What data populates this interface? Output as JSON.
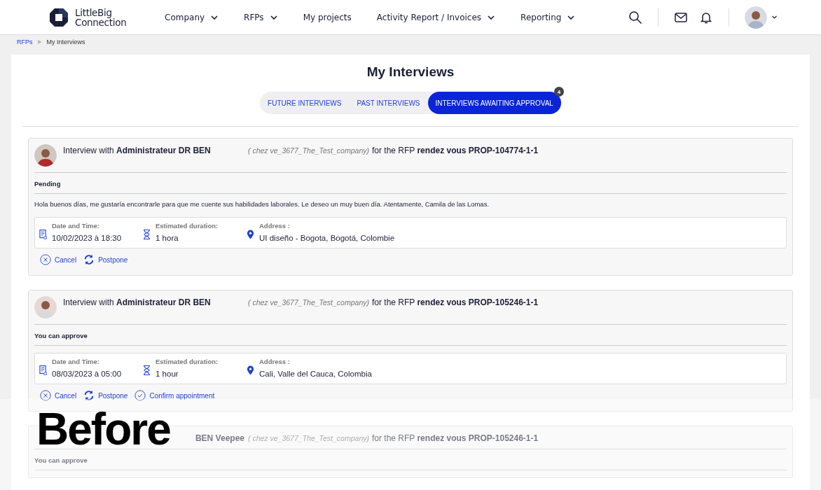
{
  "header": {
    "logo": {
      "line1": "LittleBig",
      "line2": "Connection"
    },
    "nav": [
      {
        "label": "Company",
        "dropdown": true
      },
      {
        "label": "RFPs",
        "dropdown": true
      },
      {
        "label": "My projects",
        "dropdown": false
      },
      {
        "label": "Activity Report / Invoices",
        "dropdown": true
      },
      {
        "label": "Reporting",
        "dropdown": true
      }
    ]
  },
  "breadcrumb": [
    {
      "label": "RFPs",
      "kind": "link"
    },
    {
      "label": "My Interviews",
      "kind": "current"
    }
  ],
  "title": "My Interviews",
  "tabs": [
    {
      "label": "FUTURE INTERVIEWS",
      "selected": false
    },
    {
      "label": "PAST INTERVIEWS",
      "selected": false
    },
    {
      "label": "INTERVIEWS AWAITING APPROVAL",
      "selected": true,
      "badge": "4"
    }
  ],
  "cards": [
    {
      "lead": "Interview with **Administrateur DR BEN**",
      "lead_partial": false,
      "company": "( chez ve_3677_The_Test_company)",
      "rfp": "for the RFP **rendez vous PROP-104774-1-1**",
      "status": "Pending",
      "message": "Hola buenos días, me gustaría encontrarle para que me cuente sus habilidades laborales. Le deseo un muy buen día. Atentamente, Camila de las Lomas.",
      "details": [
        {
          "kind": "date",
          "label": "Date and Time:",
          "value": "10/02/2023 à 18:30"
        },
        {
          "kind": "duration",
          "label": "Estimated duration:",
          "value": "1 hora"
        },
        {
          "kind": "address",
          "label": "Address :",
          "value": "UI diseño - Bogota, Bogotá, Colombie"
        }
      ],
      "actions": [
        {
          "kind": "cancel",
          "label": "Cancel"
        },
        {
          "kind": "postpone",
          "label": "Postpone"
        }
      ]
    },
    {
      "lead": "Interview with **Administrateur DR BEN**",
      "lead_partial": false,
      "company": "( chez ve_3677_The_Test_company)",
      "rfp": "for the RFP **rendez vous PROP-105246-1-1**",
      "status": "You can approve",
      "details": [
        {
          "kind": "date",
          "label": "Date and Time:",
          "value": "08/03/2023 à 05:00"
        },
        {
          "kind": "duration",
          "label": "Estimated duration:",
          "value": "1 hour"
        },
        {
          "kind": "address",
          "label": "Address :",
          "value": "Cali, Valle del Cauca, Colombia"
        }
      ],
      "actions": [
        {
          "kind": "cancel",
          "label": "Cancel"
        },
        {
          "kind": "postpone",
          "label": "Postpone"
        },
        {
          "kind": "confirm",
          "label": "Confirm appointment"
        }
      ]
    },
    {
      "lead": "**BEN Veepee**",
      "lead_partial": true,
      "company": "( chez ve_3677_The_Test_company)",
      "rfp": "for the RFP **rendez vous PROP-105246-1-1**",
      "status": "You can approve"
    }
  ],
  "overlay": {
    "label": "Before"
  }
}
